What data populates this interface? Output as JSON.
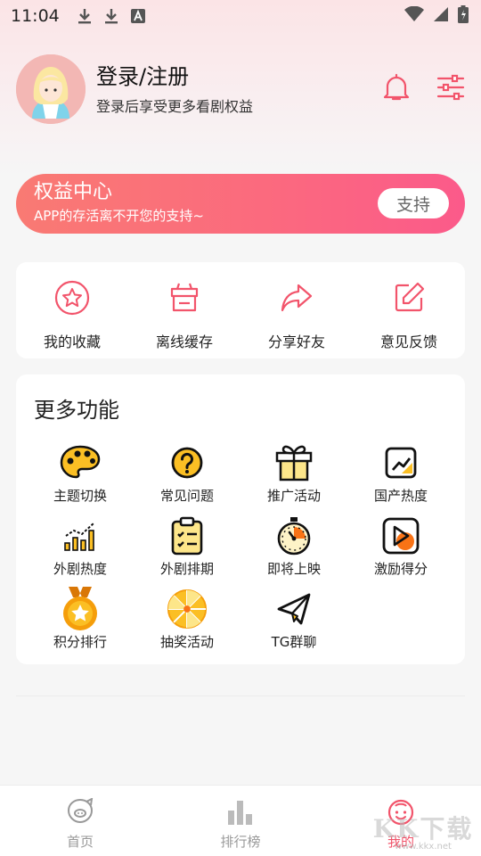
{
  "status_bar": {
    "time": "11:04"
  },
  "profile": {
    "title": "登录/注册",
    "subtitle": "登录后享受更多看剧权益"
  },
  "benefit": {
    "title": "权益中心",
    "subtitle": "APP的存活离不开您的支持~",
    "button": "支持"
  },
  "quick_actions": [
    {
      "label": "我的收藏",
      "icon": "star-circle-icon"
    },
    {
      "label": "离线缓存",
      "icon": "download-box-icon"
    },
    {
      "label": "分享好友",
      "icon": "share-arrow-icon"
    },
    {
      "label": "意见反馈",
      "icon": "edit-icon"
    }
  ],
  "more": {
    "title": "更多功能",
    "items": [
      {
        "label": "主题切换",
        "icon": "palette-icon"
      },
      {
        "label": "常见问题",
        "icon": "question-icon"
      },
      {
        "label": "推广活动",
        "icon": "gift-icon"
      },
      {
        "label": "国产热度",
        "icon": "trend-chart-icon"
      },
      {
        "label": "外剧热度",
        "icon": "bar-chart-icon"
      },
      {
        "label": "外剧排期",
        "icon": "clipboard-icon"
      },
      {
        "label": "即将上映",
        "icon": "stopwatch-icon"
      },
      {
        "label": "激励得分",
        "icon": "play-badge-icon"
      },
      {
        "label": "积分排行",
        "icon": "medal-icon"
      },
      {
        "label": "抽奖活动",
        "icon": "prize-wheel-icon"
      },
      {
        "label": "TG群聊",
        "icon": "telegram-icon"
      }
    ]
  },
  "bottom_nav": [
    {
      "label": "首页",
      "icon": "home-pig-icon",
      "active": false
    },
    {
      "label": "排行榜",
      "icon": "ranking-bars-icon",
      "active": false
    },
    {
      "label": "我的",
      "icon": "profile-face-icon",
      "active": true
    }
  ],
  "watermark": {
    "main": "KK下载",
    "sub": "www.kkx.net"
  },
  "colors": {
    "accent": "#f2546b",
    "gold": "#fbbf24"
  }
}
